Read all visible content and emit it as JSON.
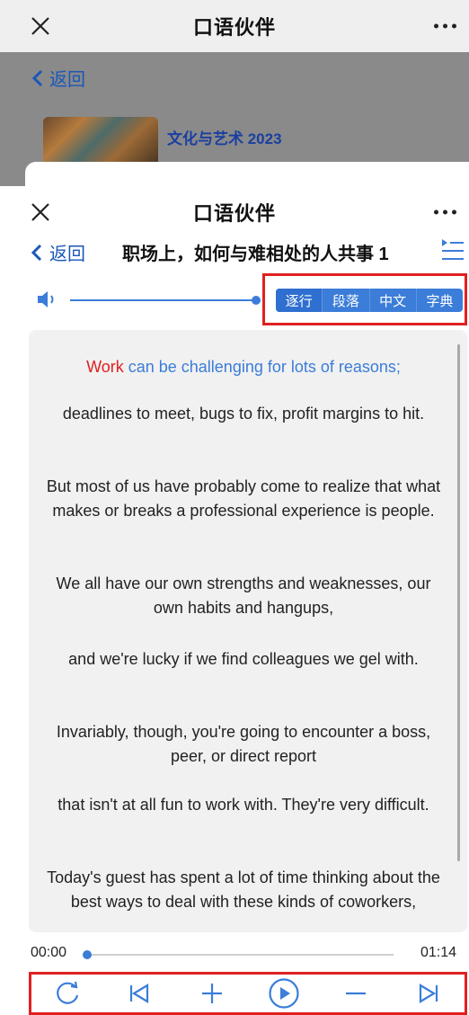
{
  "background_screen": {
    "nav": {
      "title": "口语伙伴"
    },
    "back_label": "返回",
    "course_title": "文化与艺术 2023"
  },
  "nav": {
    "title": "口语伙伴"
  },
  "header": {
    "back_label": "返回",
    "lesson_title": "职场上，如何与难相处的人共事 1"
  },
  "mode_tabs": [
    {
      "label": "逐行",
      "active": true
    },
    {
      "label": "段落",
      "active": false
    },
    {
      "label": "中文",
      "active": false
    },
    {
      "label": "字典",
      "active": false
    }
  ],
  "transcript": {
    "current": {
      "highlight": "Work",
      "rest": " can be challenging for lots of reasons;"
    },
    "sentences": [
      "deadlines to meet, bugs to fix, profit margins to hit.",
      "But most of us have probably come to realize that what makes or breaks a professional experience is people.",
      "We all have our own strengths and weaknesses, our own habits and hangups,",
      "and we're lucky if we find colleagues we gel with.",
      "Invariably, though, you're going to encounter a boss, peer, or direct report",
      "that isn't at all fun to work with. They're very difficult.",
      "Today's guest has spent a lot of time thinking about the best ways to deal with these kinds of coworkers,"
    ]
  },
  "player": {
    "current_time": "00:00",
    "total_time": "01:14",
    "controls": [
      "repeat-icon",
      "previous-icon",
      "plus-icon",
      "play-icon",
      "minus-icon",
      "next-icon"
    ]
  },
  "colors": {
    "accent": "#3b7dd8",
    "highlight_red": "#e02020",
    "link_blue": "#1a57b8"
  }
}
